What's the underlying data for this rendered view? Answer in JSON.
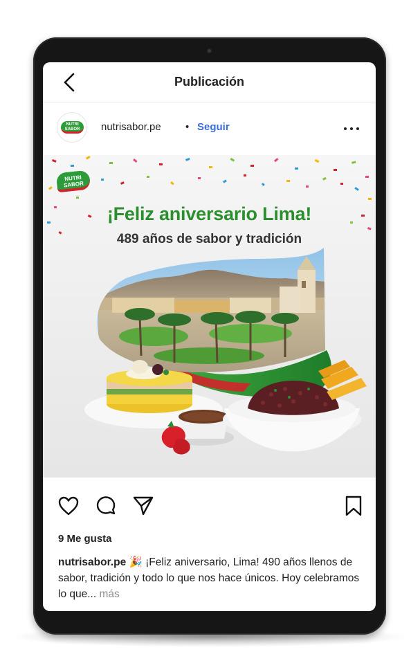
{
  "header": {
    "title": "Publicación"
  },
  "post": {
    "username": "nutrisabor.pe",
    "separator": "•",
    "follow_label": "Seguir",
    "image": {
      "logo_line1": "NUTRI",
      "logo_line2": "SABOR",
      "headline": "¡Feliz aniversario Lima!",
      "subheadline": "489 años de sabor y tradición"
    },
    "likes": "9 Me gusta",
    "caption": {
      "username": "nutrisabor.pe",
      "emoji": "🎉",
      "text": "¡Feliz aniversario, Lima! 490 años llenos de sabor, tradición y todo lo que nos hace únicos. Hoy celebramos lo que...",
      "more_label": "más"
    }
  },
  "icons": {
    "back": "chevron-left-icon",
    "more": "more-horizontal-icon",
    "like": "heart-icon",
    "comment": "comment-icon",
    "share": "send-icon",
    "save": "bookmark-icon"
  },
  "colors": {
    "accent_link": "#3b6fd6",
    "brand_green": "#2c8f2d",
    "brand_red": "#d3232a",
    "device_frame": "#161616"
  }
}
